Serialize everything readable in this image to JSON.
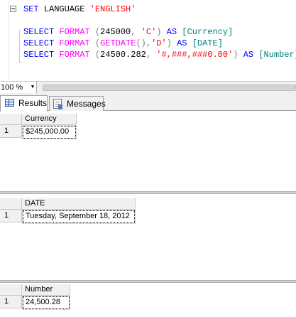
{
  "editor": {
    "line1": {
      "kw": "SET",
      "ident": " LANGUAGE ",
      "str": "'ENGLISH'"
    },
    "line3": {
      "kw": "SELECT",
      "fn": "FORMAT",
      "open": " (",
      "num": "245000",
      "comma": ", ",
      "str": "'C'",
      "close": ")",
      "as": " AS ",
      "alias": "[Currency]"
    },
    "line4": {
      "kw": "SELECT",
      "fn": "FORMAT",
      "open": " (",
      "fn2": "GETDATE",
      "paren": "()",
      "comma": ",",
      "str": "'D'",
      "close": ")",
      "as": " AS ",
      "alias": "[DATE]"
    },
    "line5": {
      "kw": "SELECT",
      "fn": "FORMAT",
      "open": " (",
      "num": "24500.282",
      "comma": ", ",
      "str": "'#,###,###0.00'",
      "close": ")",
      "as": " AS ",
      "alias": "[Number]"
    }
  },
  "zoom": {
    "value": "100 %"
  },
  "tabs": [
    {
      "label": "Results",
      "icon": "grid-icon"
    },
    {
      "label": "Messages",
      "icon": "messages-icon"
    }
  ],
  "results": [
    {
      "column": "Currency",
      "row_num": "1",
      "value": "$245,000.00"
    },
    {
      "column": "DATE",
      "row_num": "1",
      "value": "Tuesday, September 18, 2012"
    },
    {
      "column": "Number",
      "row_num": "1",
      "value": "24,500.28"
    }
  ]
}
